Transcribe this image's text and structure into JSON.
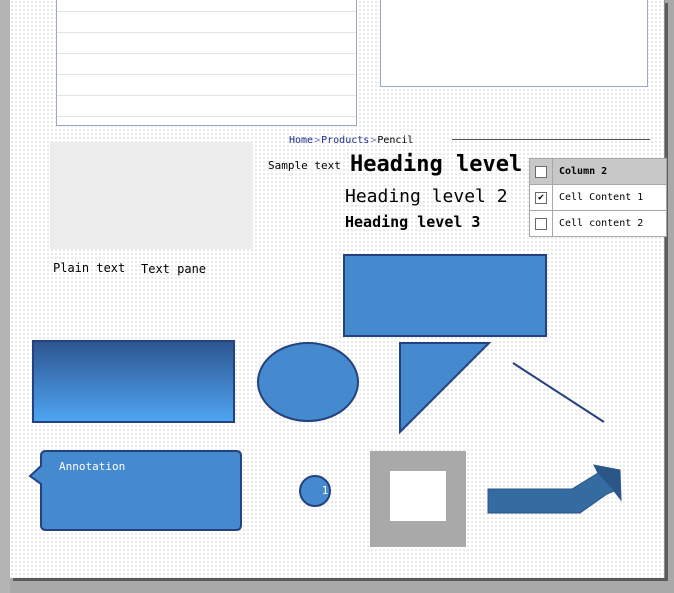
{
  "breadcrumb": {
    "items": [
      "Home",
      "Products",
      "Pencil"
    ],
    "separator": ">"
  },
  "sample_text": "Sample text",
  "headings": {
    "h1": "Heading level",
    "h2": "Heading level 2",
    "h3": "Heading level 3"
  },
  "table": {
    "header": {
      "checked": false,
      "label": "Column 2"
    },
    "rows": [
      {
        "checked": true,
        "label": "Cell Content 1"
      },
      {
        "checked": false,
        "label": "Cell content 2"
      }
    ]
  },
  "labels": {
    "plain_text": "Plain text",
    "text_pane": "Text pane"
  },
  "annotation": "Annotation",
  "badge": "1",
  "colors": {
    "shape_fill": "#4589cf",
    "shape_border": "#24427f",
    "arrow_fill": "#346ba0",
    "frame_gray": "#a9a9a9"
  }
}
